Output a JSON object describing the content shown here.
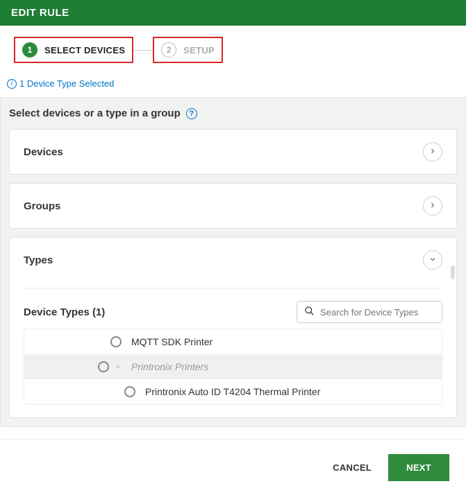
{
  "header": {
    "title": "EDIT RULE"
  },
  "stepper": {
    "step1": {
      "num": "1",
      "label": "SELECT DEVICES"
    },
    "step2": {
      "num": "2",
      "label": "SETUP"
    }
  },
  "info": {
    "text": "1 Device Type Selected"
  },
  "section": {
    "title": "Select devices or a type in a group"
  },
  "panels": {
    "devices": {
      "title": "Devices"
    },
    "groups": {
      "title": "Groups"
    },
    "types": {
      "title": "Types",
      "subtitle": "Device Types (1)",
      "search_placeholder": "Search for Device Types",
      "rows": {
        "r0": "MQTT SDK Printer",
        "r1": "Printronix Printers",
        "r2": "Printronix Auto ID T4204 Thermal Printer"
      }
    }
  },
  "footer": {
    "cancel": "CANCEL",
    "next": "NEXT"
  }
}
